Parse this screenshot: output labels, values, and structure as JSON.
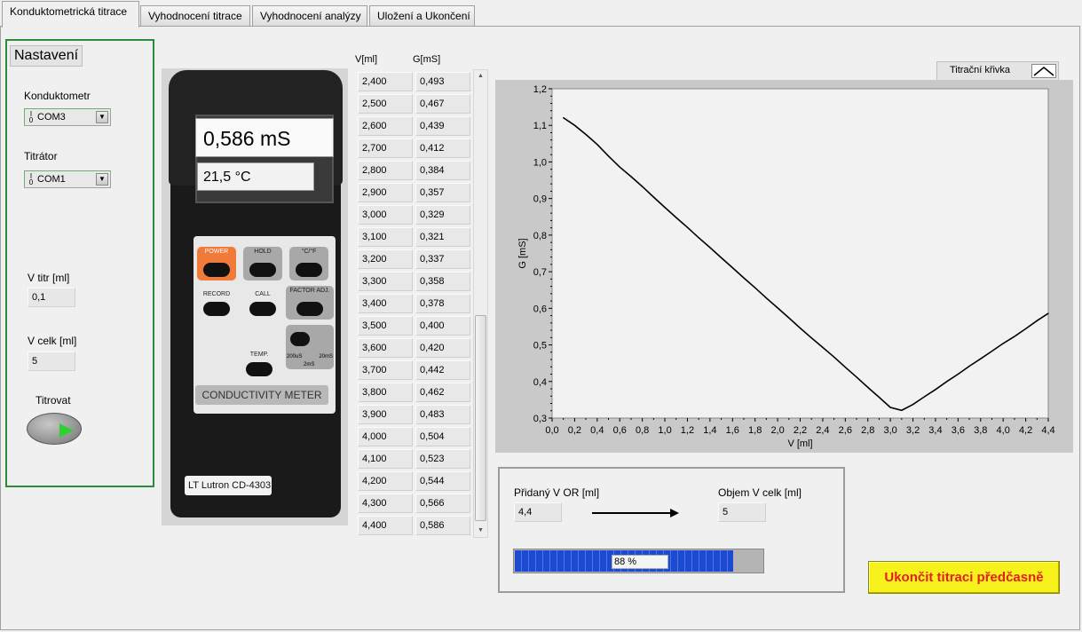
{
  "tabs": [
    {
      "label": "Konduktometrická titrace"
    },
    {
      "label": "Vyhodnocení titrace"
    },
    {
      "label": "Vyhodnocení analýzy"
    },
    {
      "label": "Uložení a Ukončení"
    }
  ],
  "settings": {
    "title": "Nastavení",
    "conductometer_label": "Konduktometr",
    "conductometer_value": "COM3",
    "titrator_label": "Titrátor",
    "titrator_value": "COM1",
    "io_glyph": "I/O",
    "v_titr_label": "V titr [ml]",
    "v_titr_value": "0,1",
    "v_celk_label": "V celk [ml]",
    "v_celk_value": "5",
    "titrovat_label": "Titrovat"
  },
  "meter": {
    "reading": "0,586 mS",
    "temperature": "21,5 °C",
    "keys": {
      "power": "POWER",
      "hold": "HOLD",
      "unit": "°C/°F",
      "record": "RECORD",
      "call": "CALL",
      "factor": "FACTOR ADJ.",
      "temp": "TEMP.",
      "range_low": "200uS",
      "range_high": "20mS",
      "range_mid": "2mS"
    },
    "title": "CONDUCTIVITY METER",
    "brand": "LT Lutron CD-4303"
  },
  "table": {
    "col_v": "V[ml]",
    "col_g": "G[mS]",
    "rows": [
      {
        "v": "2,400",
        "g": "0,493"
      },
      {
        "v": "2,500",
        "g": "0,467"
      },
      {
        "v": "2,600",
        "g": "0,439"
      },
      {
        "v": "2,700",
        "g": "0,412"
      },
      {
        "v": "2,800",
        "g": "0,384"
      },
      {
        "v": "2,900",
        "g": "0,357"
      },
      {
        "v": "3,000",
        "g": "0,329"
      },
      {
        "v": "3,100",
        "g": "0,321"
      },
      {
        "v": "3,200",
        "g": "0,337"
      },
      {
        "v": "3,300",
        "g": "0,358"
      },
      {
        "v": "3,400",
        "g": "0,378"
      },
      {
        "v": "3,500",
        "g": "0,400"
      },
      {
        "v": "3,600",
        "g": "0,420"
      },
      {
        "v": "3,700",
        "g": "0,442"
      },
      {
        "v": "3,800",
        "g": "0,462"
      },
      {
        "v": "3,900",
        "g": "0,483"
      },
      {
        "v": "4,000",
        "g": "0,504"
      },
      {
        "v": "4,100",
        "g": "0,523"
      },
      {
        "v": "4,200",
        "g": "0,544"
      },
      {
        "v": "4,300",
        "g": "0,566"
      },
      {
        "v": "4,400",
        "g": "0,586"
      }
    ]
  },
  "graph": {
    "legend_label": "Titrační křivka",
    "xlabel": "V [ml]",
    "ylabel": "G [mS]",
    "yticks": [
      "0,3",
      "0,4",
      "0,5",
      "0,6",
      "0,7",
      "0,8",
      "0,9",
      "1,0",
      "1,1",
      "1,2"
    ],
    "xticks": [
      "0,0",
      "0,2",
      "0,4",
      "0,6",
      "0,8",
      "1,0",
      "1,2",
      "1,4",
      "1,6",
      "1,8",
      "2,0",
      "2,2",
      "2,4",
      "2,6",
      "2,8",
      "3,0",
      "3,2",
      "3,4",
      "3,6",
      "3,8",
      "4,0",
      "4,2",
      "4,4"
    ]
  },
  "chart_data": {
    "type": "line",
    "xlabel": "V [ml]",
    "ylabel": "G [mS]",
    "xlim": [
      0,
      4.4
    ],
    "ylim": [
      0.3,
      1.2
    ],
    "grid": false,
    "series": [
      {
        "name": "Titrační křivka",
        "color": "#000000",
        "x": [
          0.1,
          0.2,
          0.3,
          0.4,
          0.5,
          0.6,
          0.7,
          0.8,
          0.9,
          1.0,
          1.1,
          1.2,
          1.3,
          1.4,
          1.5,
          1.6,
          1.7,
          1.8,
          1.9,
          2.0,
          2.1,
          2.2,
          2.3,
          2.4,
          2.5,
          2.6,
          2.7,
          2.8,
          2.9,
          3.0,
          3.1,
          3.2,
          3.3,
          3.4,
          3.5,
          3.6,
          3.7,
          3.8,
          3.9,
          4.0,
          4.1,
          4.2,
          4.3,
          4.4
        ],
        "y": [
          1.121,
          1.1,
          1.075,
          1.048,
          1.016,
          0.986,
          0.96,
          0.933,
          0.904,
          0.876,
          0.848,
          0.821,
          0.793,
          0.766,
          0.738,
          0.711,
          0.683,
          0.656,
          0.628,
          0.601,
          0.574,
          0.546,
          0.519,
          0.493,
          0.467,
          0.439,
          0.412,
          0.384,
          0.357,
          0.329,
          0.321,
          0.337,
          0.358,
          0.378,
          0.4,
          0.42,
          0.442,
          0.462,
          0.483,
          0.504,
          0.523,
          0.544,
          0.566,
          0.586
        ]
      }
    ]
  },
  "progress_panel": {
    "added_label": "Přidaný V OR [ml]",
    "added_value": "4,4",
    "total_label": "Objem V celk [ml]",
    "total_value": "5",
    "progress_fraction": 0.88,
    "progress_text": "88 %"
  },
  "stop_button": {
    "label": "Ukončit titraci předčasně",
    "bg_color": "#f7f21c",
    "text_color": "#e42020"
  }
}
